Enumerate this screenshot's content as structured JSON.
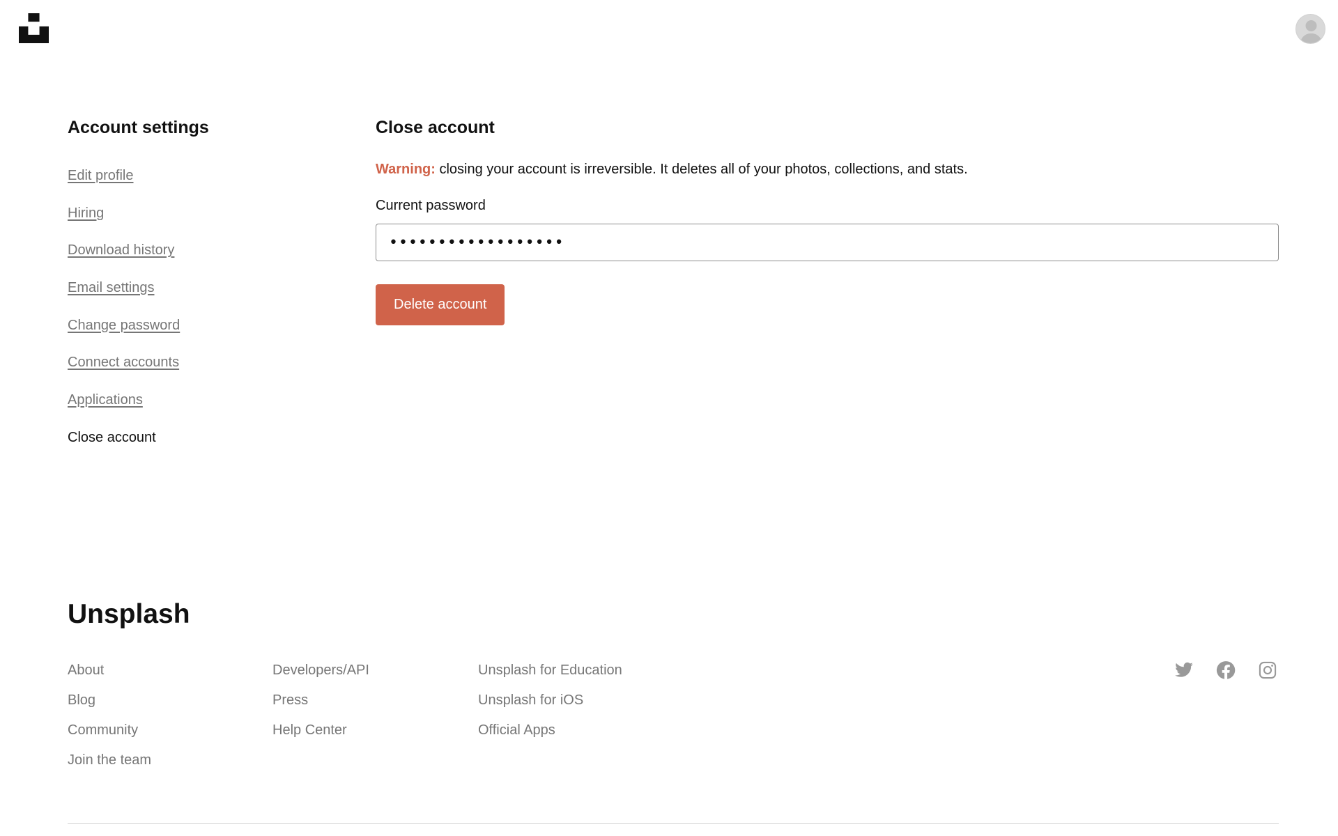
{
  "sidebar": {
    "title": "Account settings",
    "items": [
      {
        "label": "Edit profile"
      },
      {
        "label": "Hiring"
      },
      {
        "label": "Download history"
      },
      {
        "label": "Email settings"
      },
      {
        "label": "Change password"
      },
      {
        "label": "Connect accounts"
      },
      {
        "label": "Applications"
      },
      {
        "label": "Close account",
        "active": true
      }
    ]
  },
  "main": {
    "title": "Close account",
    "warning_label": "Warning:",
    "warning_text": " closing your account is irreversible. It deletes all of your photos, collections, and stats.",
    "password_label": "Current password",
    "password_value": "••••••••••••••••••",
    "delete_button": "Delete account"
  },
  "footer": {
    "brand": "Unsplash",
    "col1": [
      "About",
      "Blog",
      "Community",
      "Join the team"
    ],
    "col2": [
      "Developers/API",
      "Press",
      "Help Center"
    ],
    "col3": [
      "Unsplash for Education",
      "Unsplash for iOS",
      "Official Apps"
    ],
    "social_icons": [
      "twitter-icon",
      "facebook-icon",
      "instagram-icon"
    ]
  },
  "colors": {
    "accent": "#d0634a",
    "muted_text": "#767676",
    "text": "#111111",
    "social_icon": "#999999"
  },
  "icons": {
    "logo": "unsplash-logo-icon",
    "avatar": "user-avatar-icon"
  }
}
